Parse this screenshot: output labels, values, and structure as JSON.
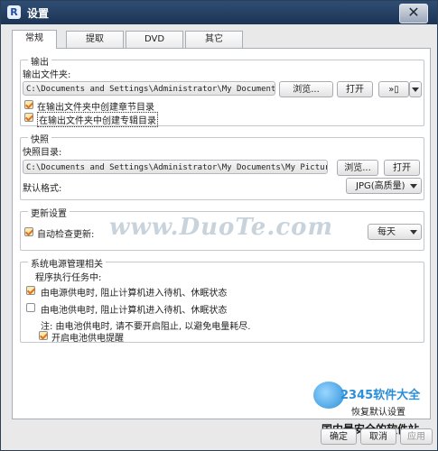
{
  "window": {
    "title": "设置"
  },
  "tabs": [
    {
      "label": "常规",
      "active": true
    },
    {
      "label": "提取",
      "active": false
    },
    {
      "label": "DVD",
      "active": false
    },
    {
      "label": "其它",
      "active": false
    }
  ],
  "output": {
    "legend": "输出",
    "folder_label": "输出文件夹:",
    "folder_path": "C:\\Documents and Settings\\Administrator\\My Documents\\My Videos",
    "browse_label": "浏览...",
    "open_label": "打开",
    "chapter_dir_label": "在输出文件夹中创建章节目录",
    "chapter_dir_checked": true,
    "album_dir_label": "在输出文件夹中创建专辑目录",
    "album_dir_checked": true
  },
  "snapshot": {
    "legend": "快照",
    "dir_label": "快照目录:",
    "dir_path": "C:\\Documents and Settings\\Administrator\\My Documents\\My Pictures",
    "browse_label": "浏览...",
    "open_label": "打开",
    "format_label": "默认格式:",
    "format_value": "JPG(高质量)"
  },
  "update": {
    "legend": "更新设置",
    "auto_check_label": "自动检查更新:",
    "auto_check_checked": true,
    "frequency_value": "每天"
  },
  "power": {
    "legend": "系统电源管理相关",
    "subtitle": "程序执行任务中:",
    "ac_label": "由电源供电时, 阻止计算机进入待机、休眠状态",
    "ac_checked": true,
    "battery_label": "由电池供电时, 阻止计算机进入待机、休眠状态",
    "battery_checked": false,
    "note": "注: 由电池供电时, 请不要开启阻止, 以避免电量耗尽.",
    "battery_alert_label": "开启电池供电提醒",
    "battery_alert_checked": true
  },
  "footer": {
    "restore_label": "恢复默认设置",
    "ok_label": "确定",
    "cancel_label": "取消",
    "apply_label": "应用"
  },
  "watermark": "www.DuoTe.com",
  "overlay": {
    "brand": "2345软件大全",
    "banner": "国内最安全的软件站"
  },
  "colors": {
    "titlebar": "#1c3454",
    "checkmark": "#e0711b",
    "accent_blue": "#2a8fd8"
  }
}
